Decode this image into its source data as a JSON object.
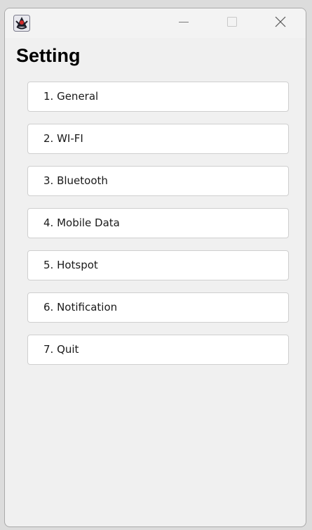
{
  "window": {
    "controls": {
      "minimize_icon": "minimize-icon",
      "maximize_icon": "maximize-icon",
      "close_icon": "close-icon"
    },
    "app_icon": "java-duke-icon"
  },
  "page": {
    "title": "Setting"
  },
  "menu": {
    "items": [
      {
        "label": "1. General"
      },
      {
        "label": "2. WI-FI"
      },
      {
        "label": "3. Bluetooth"
      },
      {
        "label": "4. Mobile Data"
      },
      {
        "label": "5. Hotspot"
      },
      {
        "label": "6. Notification"
      },
      {
        "label": "7. Quit"
      }
    ]
  },
  "colors": {
    "window_background": "#f0f0f0",
    "button_background": "#ffffff",
    "button_border": "#cfcfcf"
  }
}
